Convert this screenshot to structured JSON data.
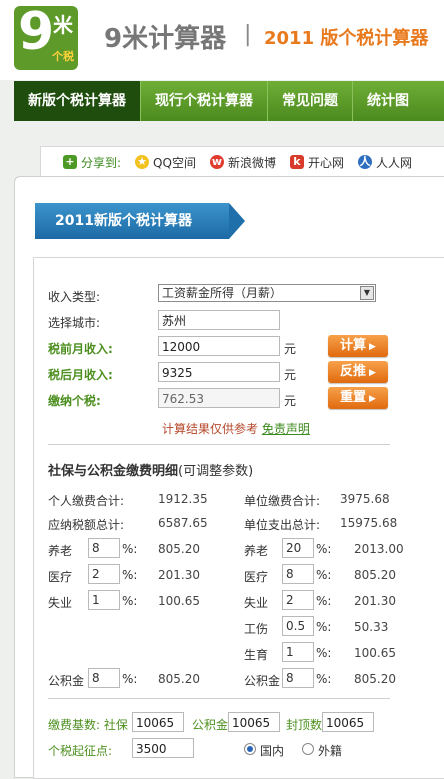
{
  "header": {
    "logo_number": "9",
    "logo_char": "米",
    "logo_sub": "个税",
    "site_name": "9米计算器",
    "separator": "|",
    "subtitle": "2011 版个税计算器"
  },
  "nav": [
    "新版个税计算器",
    "现行个税计算器",
    "常见问题",
    "统计图"
  ],
  "share": {
    "label": "分享到:",
    "items": [
      "QQ空间",
      "新浪微博",
      "开心网",
      "人人网"
    ]
  },
  "panel_title": "2011新版个税计算器",
  "form": {
    "income_type_label": "收入类型:",
    "income_type_value": "工资薪金所得（月薪）",
    "city_label": "选择城市:",
    "city_value": "苏州",
    "pretax_label": "税前月收入:",
    "pretax_value": "12000",
    "aftertax_label": "税后月收入:",
    "aftertax_value": "9325",
    "tax_label": "缴纳个税:",
    "tax_value": "762.53",
    "unit": "元",
    "calc_btn": "计算",
    "reverse_btn": "反推",
    "reset_btn": "重置",
    "note": "计算结果仅供参考",
    "disclaimer": "免责声明"
  },
  "social": {
    "title": "社保与公积金缴费明细",
    "title_sub": "(可调整参数)",
    "personal_total_label": "个人缴费合计:",
    "personal_total": "1912.35",
    "taxable_label": "应纳税额总计:",
    "taxable": "6587.65",
    "unit_total_label": "单位缴费合计:",
    "unit_total": "3975.68",
    "unit_expense_label": "单位支出总计:",
    "unit_expense": "15975.68",
    "pct": "%:",
    "personal": [
      {
        "name": "养老",
        "rate": "8",
        "amount": "805.20"
      },
      {
        "name": "医疗",
        "rate": "2",
        "amount": "201.30"
      },
      {
        "name": "失业",
        "rate": "1",
        "amount": "100.65"
      }
    ],
    "employer": [
      {
        "name": "养老",
        "rate": "20",
        "amount": "2013.00"
      },
      {
        "name": "医疗",
        "rate": "8",
        "amount": "805.20"
      },
      {
        "name": "失业",
        "rate": "2",
        "amount": "201.30"
      },
      {
        "name": "工伤",
        "rate": "0.5",
        "amount": "50.33"
      },
      {
        "name": "生育",
        "rate": "1",
        "amount": "100.65"
      }
    ],
    "housing_personal": {
      "name": "公积金",
      "rate": "8",
      "amount": "805.20"
    },
    "housing_employer": {
      "name": "公积金",
      "rate": "8",
      "amount": "805.20"
    }
  },
  "base": {
    "label": "缴费基数: 社保",
    "social_value": "10065",
    "housing_label": "公积金",
    "housing_value": "10065",
    "cap_label": "封顶数",
    "cap_value": "10065",
    "threshold_label": "个税起征点:",
    "threshold_value": "3500",
    "domestic": "国内",
    "foreign": "外籍"
  }
}
